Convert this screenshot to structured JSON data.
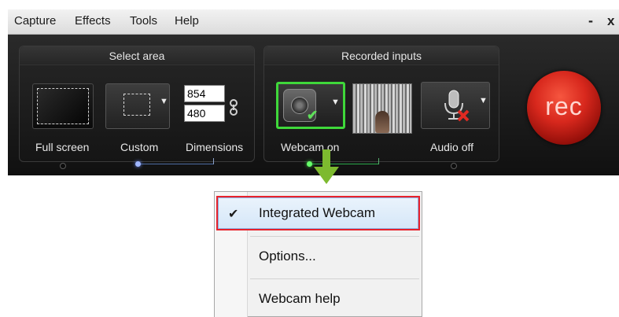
{
  "menubar": {
    "items": [
      "Capture",
      "Effects",
      "Tools",
      "Help"
    ],
    "minimize": "-",
    "close": "x"
  },
  "select_area": {
    "title": "Select area",
    "fullscreen_label": "Full screen",
    "custom_label": "Custom",
    "dimensions_label": "Dimensions",
    "width": "854",
    "height": "480"
  },
  "recorded_inputs": {
    "title": "Recorded inputs",
    "webcam_label": "Webcam on",
    "audio_label": "Audio off"
  },
  "rec_button": {
    "label": "rec"
  },
  "webcam_menu": {
    "items": [
      {
        "label": "Integrated Webcam",
        "checked": true,
        "highlighted": true
      },
      {
        "label": "Options..."
      },
      {
        "label": "Webcam help"
      }
    ],
    "check_glyph": "✔"
  },
  "colors": {
    "accent_green": "#3fd83a",
    "rec_red": "#d8281d",
    "highlight_border": "#e8222b",
    "arrow_green": "#7dba2f"
  }
}
